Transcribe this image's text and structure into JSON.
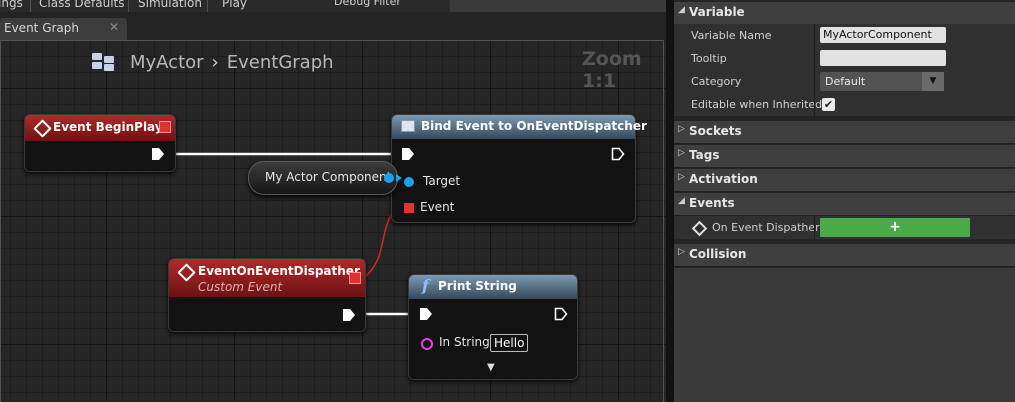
{
  "toolbar": {
    "items": [
      "ings",
      "Class Defaults",
      "Simulation",
      "Play"
    ],
    "debug_filter": "Debug Filter"
  },
  "tab": {
    "label": "Event Graph",
    "close": "✕"
  },
  "graph": {
    "breadcrumb": {
      "actor": "MyActor",
      "separator": "›",
      "graph": "EventGraph"
    },
    "zoom": "Zoom 1:1"
  },
  "nodes": {
    "begin_play": {
      "title": "Event BeginPlay"
    },
    "bind_event": {
      "title": "Bind Event to OnEventDispatcher",
      "target_label": "Target",
      "event_label": "Event"
    },
    "actor_component": {
      "label": "My Actor Component"
    },
    "custom_event": {
      "title": "EventOnEventDispather",
      "subtitle": "Custom Event"
    },
    "print_string": {
      "title": "Print String",
      "func_glyph": "f",
      "in_string_label": "In String",
      "in_string_value": "Hello",
      "expand_glyph": "▼"
    }
  },
  "details": {
    "variable": {
      "header": "Variable",
      "name_label": "Variable Name",
      "name_value": "MyActorComponent",
      "tooltip_label": "Tooltip",
      "tooltip_value": "",
      "category_label": "Category",
      "category_value": "Default",
      "editable_label": "Editable when Inherited",
      "editable_checked": true,
      "check_glyph": "✔"
    },
    "sockets": "Sockets",
    "tags": "Tags",
    "activation": "Activation",
    "events": {
      "header": "Events",
      "dispatcher_label": "On Event Dispather",
      "add_glyph": "+"
    },
    "collision": "Collision"
  },
  "colors": {
    "event_header": "#b02a2a",
    "function_header": "#7d9ab3",
    "object_pin": "#1ca0f0",
    "delegate_pin": "#e8302e",
    "string_pin": "#e040e0",
    "add_button": "#4aaa4a"
  }
}
